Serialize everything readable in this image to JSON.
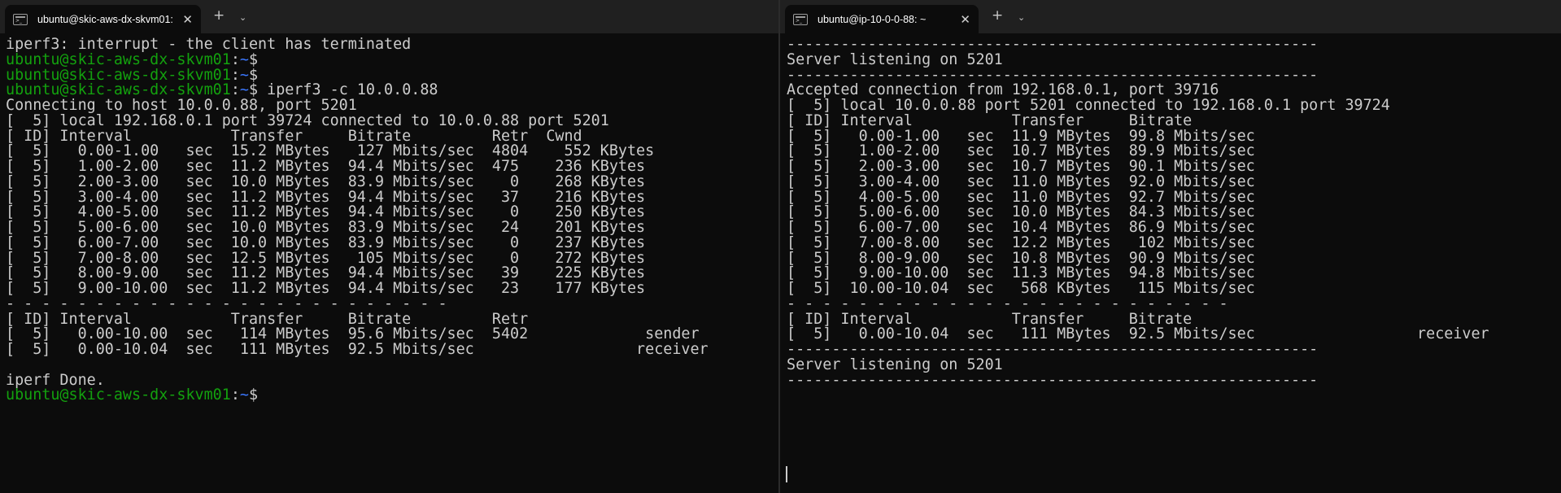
{
  "left": {
    "tab_title": "ubuntu@skic-aws-dx-skvm01:",
    "new_tab": "+",
    "dropdown": "⌄",
    "close": "✕",
    "prompt": {
      "user_host": "ubuntu@skic-aws-dx-skvm01",
      "sep": ":",
      "path": "~",
      "sigil": "$ "
    },
    "lines": [
      {
        "text": "iperf3: interrupt - the client has terminated"
      },
      {
        "prompt": true,
        "cmd": ""
      },
      {
        "prompt": true,
        "cmd": ""
      },
      {
        "prompt": true,
        "cmd": "iperf3 -c 10.0.0.88"
      },
      {
        "text": "Connecting to host 10.0.0.88, port 5201"
      },
      {
        "text": "[  5] local 192.168.0.1 port 39724 connected to 10.0.0.88 port 5201"
      },
      {
        "text": "[ ID] Interval           Transfer     Bitrate         Retr  Cwnd"
      },
      {
        "text": "[  5]   0.00-1.00   sec  15.2 MBytes   127 Mbits/sec  4804    552 KBytes"
      },
      {
        "text": "[  5]   1.00-2.00   sec  11.2 MBytes  94.4 Mbits/sec  475    236 KBytes"
      },
      {
        "text": "[  5]   2.00-3.00   sec  10.0 MBytes  83.9 Mbits/sec    0    268 KBytes"
      },
      {
        "text": "[  5]   3.00-4.00   sec  11.2 MBytes  94.4 Mbits/sec   37    216 KBytes"
      },
      {
        "text": "[  5]   4.00-5.00   sec  11.2 MBytes  94.4 Mbits/sec    0    250 KBytes"
      },
      {
        "text": "[  5]   5.00-6.00   sec  10.0 MBytes  83.9 Mbits/sec   24    201 KBytes"
      },
      {
        "text": "[  5]   6.00-7.00   sec  10.0 MBytes  83.9 Mbits/sec    0    237 KBytes"
      },
      {
        "text": "[  5]   7.00-8.00   sec  12.5 MBytes   105 Mbits/sec    0    272 KBytes"
      },
      {
        "text": "[  5]   8.00-9.00   sec  11.2 MBytes  94.4 Mbits/sec   39    225 KBytes"
      },
      {
        "text": "[  5]   9.00-10.00  sec  11.2 MBytes  94.4 Mbits/sec   23    177 KBytes"
      },
      {
        "text": "- - - - - - - - - - - - - - - - - - - - - - - - -"
      },
      {
        "text": "[ ID] Interval           Transfer     Bitrate         Retr"
      },
      {
        "text": "[  5]   0.00-10.00  sec   114 MBytes  95.6 Mbits/sec  5402             sender"
      },
      {
        "text": "[  5]   0.00-10.04  sec   111 MBytes  92.5 Mbits/sec                  receiver"
      },
      {
        "text": ""
      },
      {
        "text": "iperf Done."
      },
      {
        "prompt": true,
        "cmd": ""
      }
    ]
  },
  "right": {
    "tab_title": "ubuntu@ip-10-0-0-88: ~",
    "new_tab": "+",
    "dropdown": "⌄",
    "close": "✕",
    "lines": [
      {
        "text": "-----------------------------------------------------------"
      },
      {
        "text": "Server listening on 5201"
      },
      {
        "text": "-----------------------------------------------------------"
      },
      {
        "text": "Accepted connection from 192.168.0.1, port 39716"
      },
      {
        "text": "[  5] local 10.0.0.88 port 5201 connected to 192.168.0.1 port 39724"
      },
      {
        "text": "[ ID] Interval           Transfer     Bitrate"
      },
      {
        "text": "[  5]   0.00-1.00   sec  11.9 MBytes  99.8 Mbits/sec"
      },
      {
        "text": "[  5]   1.00-2.00   sec  10.7 MBytes  89.9 Mbits/sec"
      },
      {
        "text": "[  5]   2.00-3.00   sec  10.7 MBytes  90.1 Mbits/sec"
      },
      {
        "text": "[  5]   3.00-4.00   sec  11.0 MBytes  92.0 Mbits/sec"
      },
      {
        "text": "[  5]   4.00-5.00   sec  11.0 MBytes  92.7 Mbits/sec"
      },
      {
        "text": "[  5]   5.00-6.00   sec  10.0 MBytes  84.3 Mbits/sec"
      },
      {
        "text": "[  5]   6.00-7.00   sec  10.4 MBytes  86.9 Mbits/sec"
      },
      {
        "text": "[  5]   7.00-8.00   sec  12.2 MBytes   102 Mbits/sec"
      },
      {
        "text": "[  5]   8.00-9.00   sec  10.8 MBytes  90.9 Mbits/sec"
      },
      {
        "text": "[  5]   9.00-10.00  sec  11.3 MBytes  94.8 Mbits/sec"
      },
      {
        "text": "[  5]  10.00-10.04  sec   568 KBytes   115 Mbits/sec"
      },
      {
        "text": "- - - - - - - - - - - - - - - - - - - - - - - - -"
      },
      {
        "text": "[ ID] Interval           Transfer     Bitrate"
      },
      {
        "text": "[  5]   0.00-10.04  sec   111 MBytes  92.5 Mbits/sec                  receiver"
      },
      {
        "text": "-----------------------------------------------------------"
      },
      {
        "text": "Server listening on 5201"
      },
      {
        "text": "-----------------------------------------------------------"
      }
    ]
  }
}
